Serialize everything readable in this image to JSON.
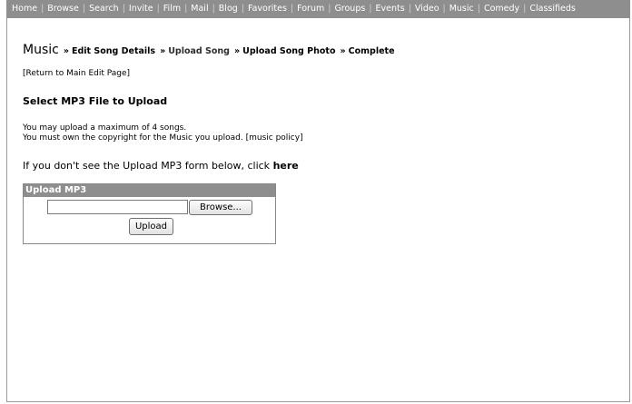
{
  "topnav": {
    "items": [
      "Home",
      "Browse",
      "Search",
      "Invite",
      "Film",
      "Mail",
      "Blog",
      "Favorites",
      "Forum",
      "Groups",
      "Events",
      "Video",
      "Music",
      "Comedy",
      "Classifieds"
    ],
    "separator": "|"
  },
  "breadcrumb": {
    "title": "Music",
    "arrow": "»",
    "steps": [
      "Edit Song Details",
      "Upload Song",
      "Upload Song Photo",
      "Complete"
    ]
  },
  "return_link": "[Return to Main Edit Page]",
  "section_title": "Select MP3 File to Upload",
  "info": {
    "line1": "You may upload a maximum of 4 songs.",
    "line2": "You must own the copyright for the Music you upload.",
    "policy_link": "[music policy]"
  },
  "fallback": {
    "text": "If you don't see the Upload MP3 form below, click",
    "link": "here"
  },
  "upload_form": {
    "heading": "Upload MP3",
    "file_value": "",
    "browse_label": "Browse...",
    "upload_label": "Upload"
  }
}
